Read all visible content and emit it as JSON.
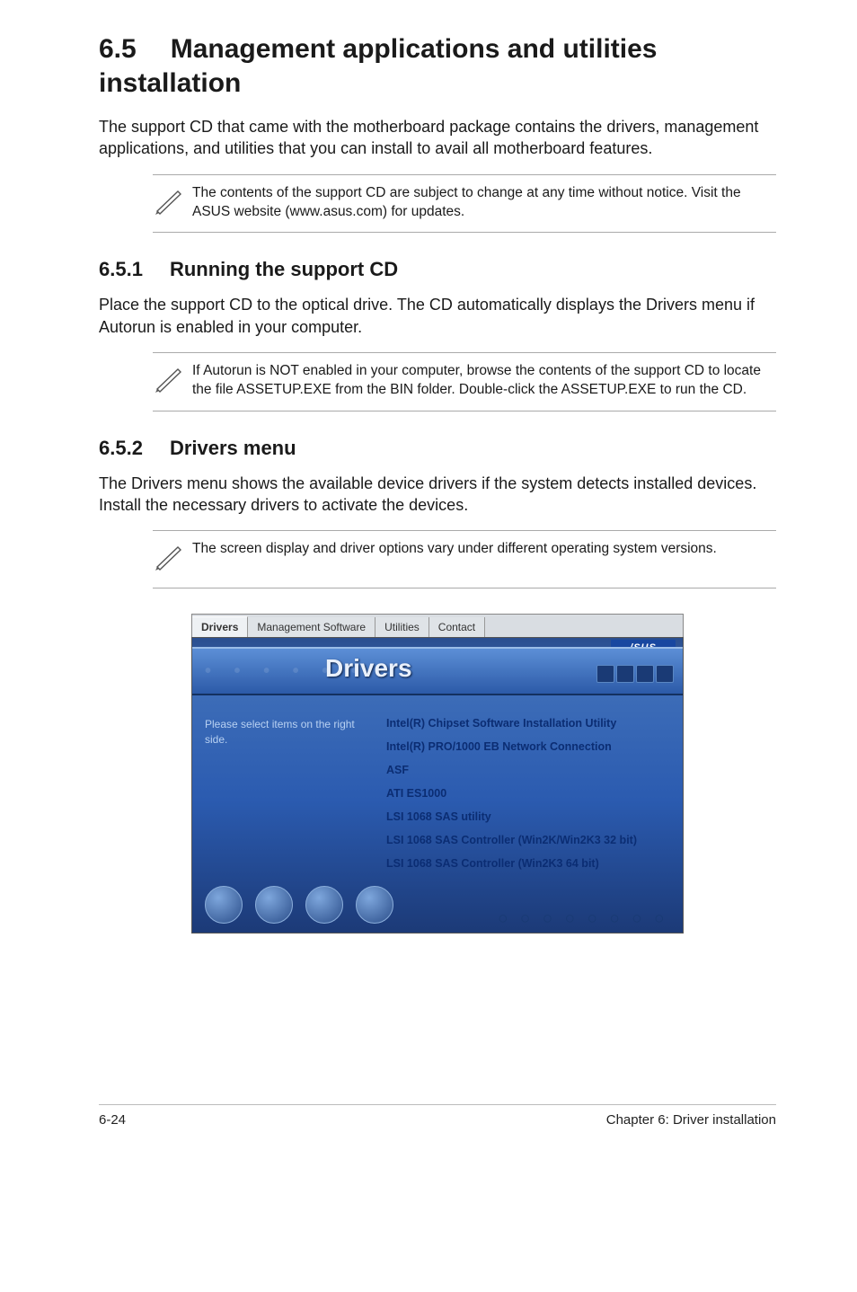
{
  "section": {
    "number": "6.5",
    "title": "Management applications and utilities installation"
  },
  "intro": "The support CD that came with the motherboard package contains the drivers, management applications, and utilities that you can install to avail all  motherboard features.",
  "note1": "The contents of the support CD are subject to change at any time without notice. Visit the ASUS website (www.asus.com) for updates.",
  "sub1": {
    "number": "6.5.1",
    "title": "Running the support CD"
  },
  "sub1_body": "Place the support CD to the optical drive. The CD automatically displays the Drivers menu if Autorun is enabled in your computer.",
  "note2": "If Autorun is NOT enabled in your computer, browse the contents of the support CD to locate the file ASSETUP.EXE from the BIN folder. Double-click the ASSETUP.EXE to run the CD.",
  "sub2": {
    "number": "6.5.2",
    "title": "Drivers menu"
  },
  "sub2_body": "The Drivers menu shows the available device drivers if the system detects installed devices. Install the necessary drivers to activate the devices.",
  "note3": "The screen display and driver options vary under different operating system versions.",
  "app": {
    "tabs": [
      "Drivers",
      "Management Software",
      "Utilities",
      "Contact"
    ],
    "active_tab": 0,
    "logo": "/SUS",
    "header": "Drivers",
    "left_text": "Please select items on the right side.",
    "links": [
      "Intel(R) Chipset Software Installation Utility",
      "Intel(R) PRO/1000 EB Network Connection",
      "ASF",
      "ATI ES1000",
      "LSI 1068 SAS utility",
      "LSI 1068 SAS Controller (Win2K/Win2K3 32 bit)",
      "LSI 1068 SAS Controller (Win2K3 64 bit)"
    ]
  },
  "footer": {
    "left": "6-24",
    "right": "Chapter 6: Driver installation"
  }
}
